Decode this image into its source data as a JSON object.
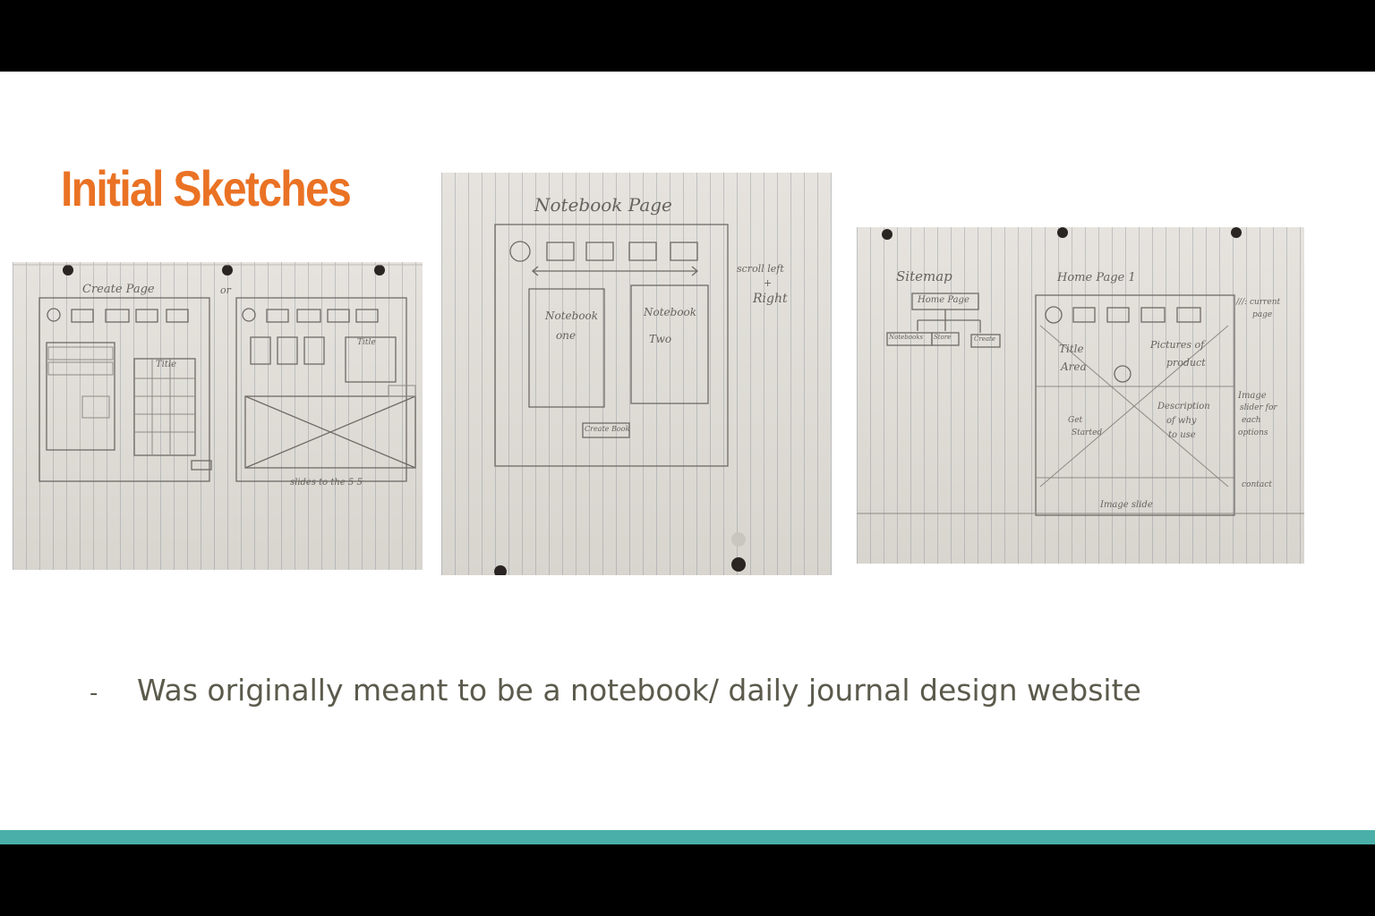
{
  "slide": {
    "title": "Initial Sketches",
    "bullets": [
      {
        "marker": "-",
        "text": "Was originally meant to be a notebook/ daily journal design website"
      }
    ]
  },
  "sketches": {
    "create_page": {
      "heading": "Create Page",
      "or_label": "or",
      "title_box": "Title",
      "title_right": "Title",
      "footnote": "slides to the 5 5"
    },
    "notebook_page": {
      "heading": "Notebook Page",
      "scroll_note_1": "scroll left",
      "scroll_note_2": "+",
      "scroll_note_3": "Right",
      "notebook_one_1": "Notebook",
      "notebook_one_2": "one",
      "notebook_two_1": "Notebook",
      "notebook_two_2": "Two",
      "create_button": "Create Book"
    },
    "sitemap_home": {
      "sitemap_heading": "Sitemap",
      "sitemap_root": "Home Page",
      "sitemap_children": [
        "Notebooks",
        "Store",
        "Create"
      ],
      "home_heading": "Home Page 1",
      "current_page_1": "///: current",
      "current_page_2": "page",
      "title_area_1": "Title",
      "title_area_2": "Area",
      "pictures_1": "Pictures of",
      "pictures_2": "product",
      "get_started_1": "Get",
      "get_started_2": "Started",
      "description_1": "Description",
      "description_2": "of why",
      "description_3": "to use",
      "image_slider_1": "Image",
      "image_slider_2": "slider for",
      "image_slider_3": "each",
      "image_slider_4": "options",
      "contact": "contact",
      "image_slide": "Image slide"
    }
  },
  "colors": {
    "title": "#ea7224",
    "accent_bar": "#4aafa8",
    "body_text": "#5b5a4c"
  }
}
